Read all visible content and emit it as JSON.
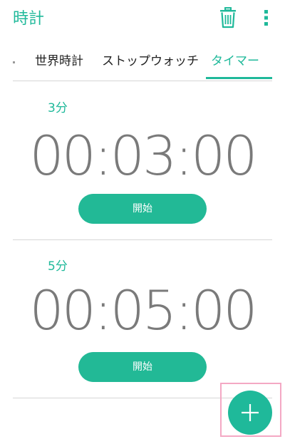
{
  "app": {
    "title": "時計"
  },
  "toolbar": {
    "delete_icon": "trash-icon",
    "more_icon": "more-vert-icon"
  },
  "tabs": [
    {
      "label": "世界時計",
      "selected": false
    },
    {
      "label": "ストップウォッチ",
      "selected": false
    },
    {
      "label": "タイマー",
      "selected": true
    }
  ],
  "timers": [
    {
      "label": "3分",
      "time": "00:03:00",
      "start_label": "開始"
    },
    {
      "label": "5分",
      "time": "00:05:00",
      "start_label": "開始"
    }
  ],
  "fab": {
    "icon": "plus-icon"
  },
  "colors": {
    "accent": "#1fb99a",
    "button": "#22b996",
    "time_text": "#7a7a7a",
    "highlight": "#f4a8c4"
  }
}
